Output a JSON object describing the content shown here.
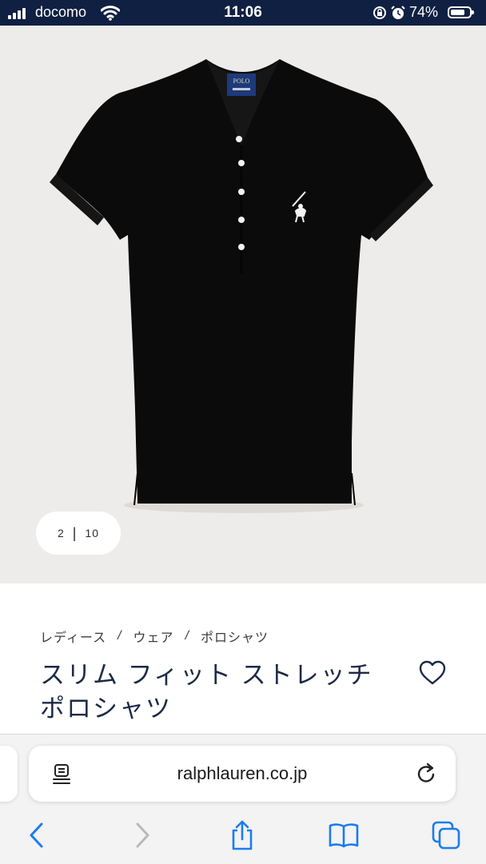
{
  "status_bar": {
    "carrier": "docomo",
    "time": "11:06",
    "battery_percent": "74%",
    "battery_level": 0.74
  },
  "gallery": {
    "current": "2",
    "separator": "|",
    "total": "10"
  },
  "product": {
    "breadcrumb": [
      "レディース",
      "ウェア",
      "ポロシャツ"
    ],
    "breadcrumb_separator": "/",
    "title": "スリム フィット ストレッチ ポロシャツ",
    "collar_label": "POLO"
  },
  "browser": {
    "url": "ralphlauren.co.jp"
  },
  "icons": {
    "signal": "signal-bars-icon",
    "wifi": "wifi-icon",
    "orientation_lock": "orientation-lock-icon",
    "alarm": "alarm-icon",
    "battery": "battery-icon",
    "wishlist": "heart-icon",
    "reader": "reader-mode-icon",
    "reload": "reload-icon",
    "back": "chevron-left-icon",
    "forward": "chevron-right-icon",
    "share": "share-icon",
    "bookmarks": "book-icon",
    "tabs": "tabs-icon"
  },
  "colors": {
    "status_bar_bg": "#102043",
    "image_bg": "#eeecea",
    "title_text": "#1d2a45",
    "safari_blue": "#1a7cf0",
    "shirt": "#0b0b0b"
  }
}
